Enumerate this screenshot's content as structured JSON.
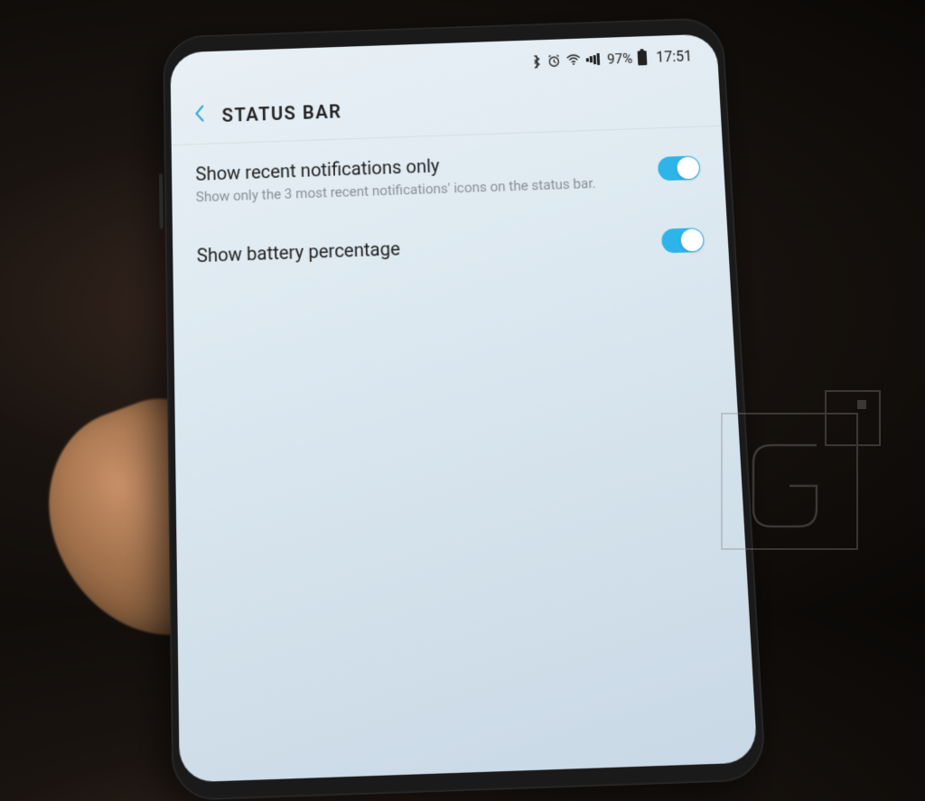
{
  "statusbar": {
    "battery_percentage": "97%",
    "time": "17:51"
  },
  "header": {
    "title": "STATUS BAR"
  },
  "settings": {
    "recent_notifications": {
      "title": "Show recent notifications only",
      "description": "Show only the 3 most recent notifications' icons on the status bar.",
      "enabled": true
    },
    "battery_percentage": {
      "title": "Show battery percentage",
      "enabled": true
    }
  }
}
